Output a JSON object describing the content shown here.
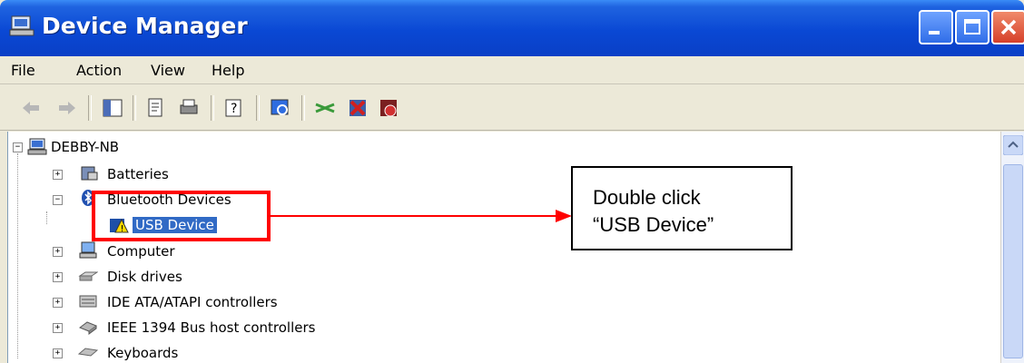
{
  "window": {
    "title": "Device Manager",
    "controls": {
      "minimize": "minimize",
      "maximize": "maximize",
      "close": "close"
    }
  },
  "menubar": {
    "items": [
      "File",
      "Action",
      "View",
      "Help"
    ]
  },
  "toolbar": {
    "icons": [
      "back-arrow-icon",
      "forward-arrow-icon",
      "console-tree-icon",
      "properties-icon",
      "print-icon",
      "help-icon",
      "scan-hardware-icon",
      "update-driver-icon",
      "uninstall-icon",
      "disable-icon"
    ]
  },
  "tree": {
    "root": "DEBBY-NB",
    "items": [
      {
        "label": "Batteries",
        "expander": "+"
      },
      {
        "label": "Bluetooth Devices",
        "expander": "−"
      },
      {
        "label": "USB Device",
        "child": true,
        "selected": true
      },
      {
        "label": "Computer",
        "expander": "+"
      },
      {
        "label": "Disk drives",
        "expander": "+"
      },
      {
        "label": "IDE ATA/ATAPI controllers",
        "expander": "+"
      },
      {
        "label": "IEEE 1394 Bus host controllers",
        "expander": "+"
      },
      {
        "label": "Keyboards",
        "expander": "+"
      }
    ]
  },
  "annotation": {
    "callout_text": "Double click\n“USB Device”",
    "highlight_color": "#ff0000"
  },
  "colors": {
    "titlebar": "#0a48d4",
    "selection": "#316ac5",
    "chrome": "#ece9d8"
  }
}
